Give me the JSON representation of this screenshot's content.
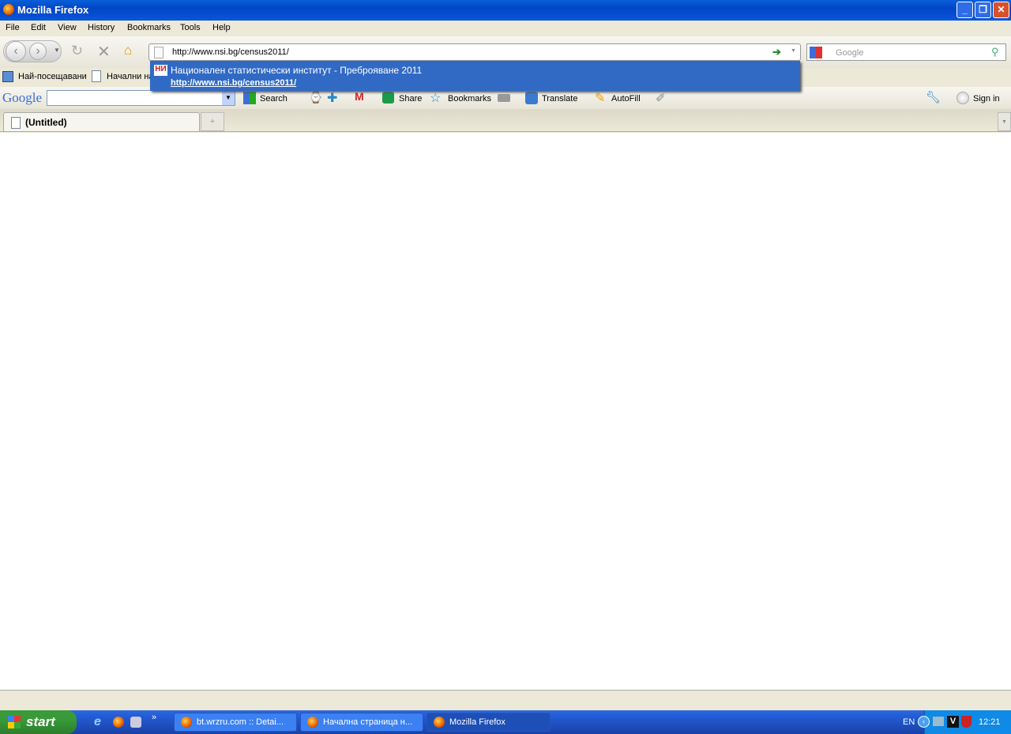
{
  "window": {
    "title": "Mozilla Firefox"
  },
  "menu": [
    "File",
    "Edit",
    "View",
    "History",
    "Bookmarks",
    "Tools",
    "Help"
  ],
  "nav": {
    "url": "http://www.nsi.bg/census2011/",
    "search_placeholder": "Google"
  },
  "bookmarks": [
    "Най-посещавани",
    "Начални на"
  ],
  "autocomplete": {
    "title": "Национален статистически институт - Преброяване 2011",
    "url": "http://www.nsi.bg/census2011/"
  },
  "google_toolbar": {
    "logo": "Google",
    "search": "Search",
    "share": "Share",
    "bookmarks": "Bookmarks",
    "translate": "Translate",
    "autofill": "AutoFill",
    "signin": "Sign in"
  },
  "tabs": [
    {
      "label": "(Untitled)"
    }
  ],
  "taskbar": {
    "start": "start",
    "tasks": [
      "bt.wrzru.com :: Detai...",
      "Начална страница н...",
      "Mozilla Firefox"
    ],
    "lang": "EN",
    "clock": "12:21"
  }
}
